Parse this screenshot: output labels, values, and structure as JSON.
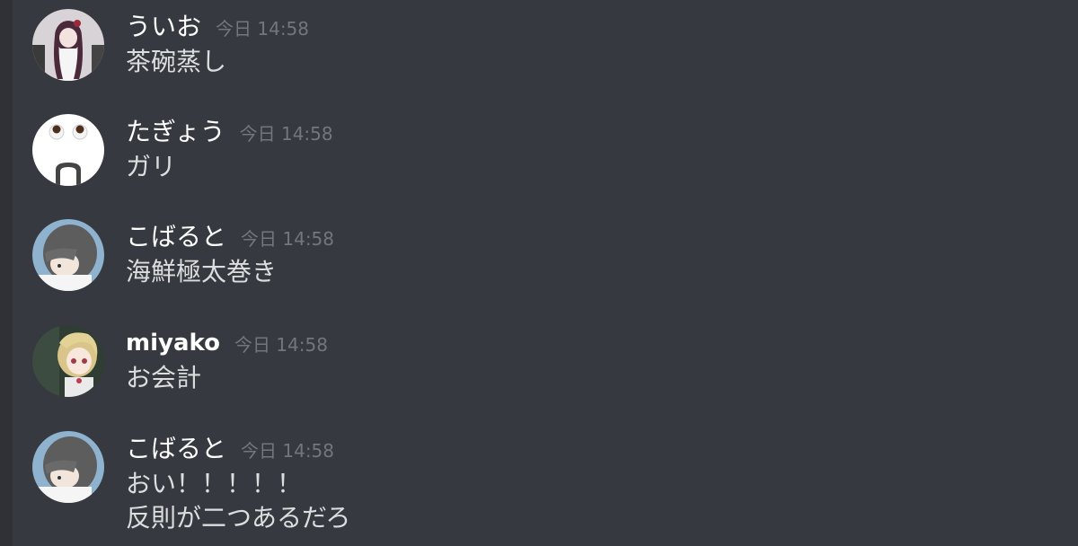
{
  "messages": [
    {
      "username": "ういお",
      "timestamp": "今日 14:58",
      "lines": [
        "茶碗蒸し"
      ],
      "avatar_icon": "anime-girl-avatar-icon"
    },
    {
      "username": "たぎょう",
      "timestamp": "今日 14:58",
      "lines": [
        "ガリ"
      ],
      "avatar_icon": "surprised-face-avatar-icon"
    },
    {
      "username": "こばると",
      "timestamp": "今日 14:58",
      "lines": [
        "海鮮極太巻き"
      ],
      "avatar_icon": "dark-haired-boy-avatar-icon"
    },
    {
      "username": "miyako",
      "timestamp": "今日 14:58",
      "lines": [
        "お会計"
      ],
      "avatar_icon": "blonde-girl-avatar-icon"
    },
    {
      "username": "こばると",
      "timestamp": "今日 14:58",
      "lines": [
        "おい！！！！！",
        "反則が二つあるだろ"
      ],
      "avatar_icon": "dark-haired-boy-avatar-icon"
    }
  ],
  "colors": {
    "background": "#36393f",
    "sidebar_strip": "#2f3136",
    "username": "#ffffff",
    "timestamp": "#72767d",
    "message_text": "#dcddde"
  }
}
